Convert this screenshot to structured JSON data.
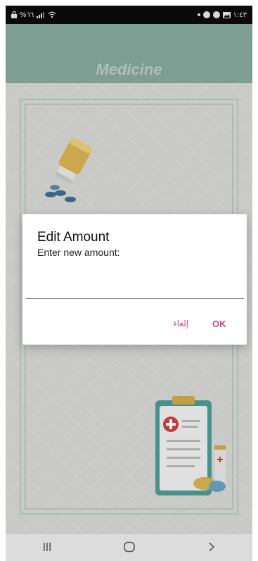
{
  "status_bar": {
    "left_text": "%٦٦",
    "time": "١:٤٣"
  },
  "app_bar": {
    "title": "Medicine"
  },
  "dialog": {
    "title": "Edit Amount",
    "message": "Enter new amount:",
    "input_value": "",
    "cancel_label": "إلغاء",
    "ok_label": "OK"
  },
  "colors": {
    "app_bar": "#86a79d",
    "accent": "#d4418a"
  },
  "icons": {
    "nav_recents": "recents-icon",
    "nav_home": "home-icon",
    "nav_back": "back-icon"
  }
}
